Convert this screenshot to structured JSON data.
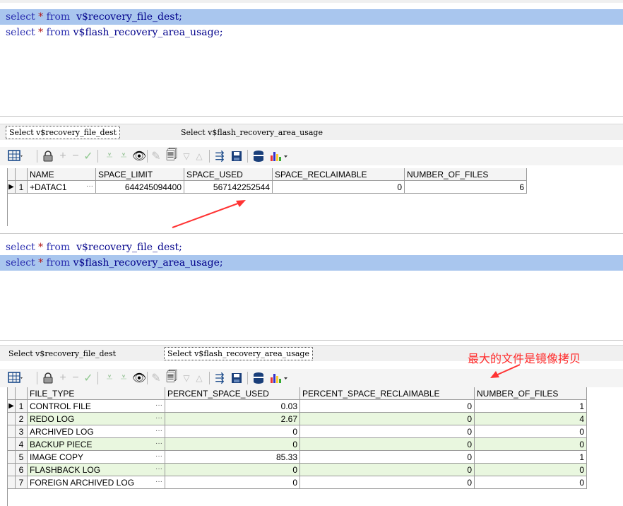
{
  "editor_top": {
    "lines": [
      {
        "kw1": "select",
        "op": "*",
        "kw2": "from",
        "rest": "v$recovery_file_dest;",
        "highlighted": true
      },
      {
        "kw1": "select",
        "op": "*",
        "kw2": "from",
        "rest": "v$flash_recovery_area_usage;",
        "highlighted": false
      }
    ]
  },
  "results_top": {
    "tabs": [
      "Select v$recovery_file_dest",
      "Select v$flash_recovery_area_usage"
    ],
    "active_tab": 0,
    "columns": [
      "NAME",
      "SPACE_LIMIT",
      "SPACE_USED",
      "SPACE_RECLAIMABLE",
      "NUMBER_OF_FILES"
    ],
    "rows": [
      {
        "num": "1",
        "cells": [
          "+DATAC1",
          "644245094400",
          "567142252544",
          "0",
          "6"
        ]
      }
    ]
  },
  "editor_bottom": {
    "lines": [
      {
        "kw1": "select",
        "op": "*",
        "kw2": "from",
        "rest": "v$recovery_file_dest;",
        "highlighted": false
      },
      {
        "kw1": "select",
        "op": "*",
        "kw2": "from",
        "rest": "v$flash_recovery_area_usage;",
        "highlighted": true
      }
    ]
  },
  "results_bottom": {
    "tabs": [
      "Select v$recovery_file_dest",
      "Select v$flash_recovery_area_usage"
    ],
    "active_tab": 1,
    "columns": [
      "FILE_TYPE",
      "PERCENT_SPACE_USED",
      "PERCENT_SPACE_RECLAIMABLE",
      "NUMBER_OF_FILES"
    ],
    "rows": [
      {
        "num": "1",
        "cells": [
          "CONTROL FILE",
          "0.03",
          "0",
          "1"
        ]
      },
      {
        "num": "2",
        "cells": [
          "REDO LOG",
          "2.67",
          "0",
          "4"
        ]
      },
      {
        "num": "3",
        "cells": [
          "ARCHIVED LOG",
          "0",
          "0",
          "0"
        ]
      },
      {
        "num": "4",
        "cells": [
          "BACKUP PIECE",
          "0",
          "0",
          "0"
        ]
      },
      {
        "num": "5",
        "cells": [
          "IMAGE COPY",
          "85.33",
          "0",
          "1"
        ]
      },
      {
        "num": "6",
        "cells": [
          "FLASHBACK LOG",
          "0",
          "0",
          "0"
        ]
      },
      {
        "num": "7",
        "cells": [
          "FOREIGN ARCHIVED LOG",
          "0",
          "0",
          "0"
        ]
      }
    ]
  },
  "annotation": "最大的文件是镜像拷贝",
  "toolbar_icons": [
    "grid-view-icon",
    "lock-icon",
    "add-icon",
    "remove-icon",
    "post-icon",
    "filter-icon",
    "filter-clear-icon",
    "find-icon",
    "clear-icon",
    "query-icon",
    "sort-down-icon",
    "sort-up-icon",
    "connect-icon",
    "save-icon",
    "export-icon",
    "chart-icon"
  ],
  "colors": {
    "highlight": "#a9c6ee",
    "alt_row": "#e9f7df",
    "annotation": "#ff2a2a"
  }
}
